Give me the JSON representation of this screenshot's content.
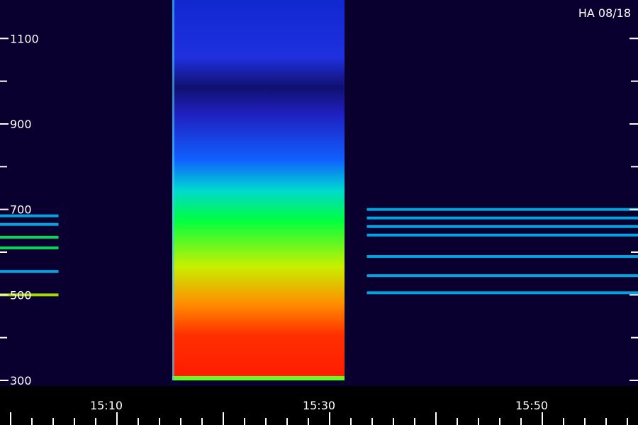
{
  "chart_data": {
    "type": "heatmap",
    "title": "",
    "label_top_right": "HA 08/18",
    "xlabel": "",
    "ylabel": "",
    "xlim": [
      "15:02",
      "15:38"
    ],
    "ylim": [
      300,
      1190
    ],
    "x_tick_labels": [
      "15:10",
      "15:30",
      "15:50"
    ],
    "x_tick_minutes": [
      10,
      30,
      50
    ],
    "y_tick_values": [
      300,
      500,
      700,
      900,
      1100
    ],
    "y_minor_tick_values": [
      400,
      600,
      800,
      1000
    ],
    "grid": false,
    "colormap": [
      "#0a0030",
      "#1020d0",
      "#00c0ff",
      "#00ff60",
      "#c0ff00",
      "#ff8000",
      "#ff1000"
    ],
    "background_color": "#0a0030",
    "bands": [
      {
        "t_start_min": 16.2,
        "t_end_min": 32.4,
        "f_min": 300,
        "f_max": 1190,
        "intensity_low": 0.9,
        "intensity_high": 0.35
      }
    ],
    "lines": [
      {
        "t_start_min": 0,
        "t_end_min": 5.5,
        "freq": 500,
        "intensity": 0.6
      },
      {
        "t_start_min": 0,
        "t_end_min": 5.5,
        "freq": 555,
        "intensity": 0.4
      },
      {
        "t_start_min": 0,
        "t_end_min": 5.5,
        "freq": 610,
        "intensity": 0.5
      },
      {
        "t_start_min": 0,
        "t_end_min": 5.5,
        "freq": 635,
        "intensity": 0.5
      },
      {
        "t_start_min": 0,
        "t_end_min": 5.5,
        "freq": 665,
        "intensity": 0.4
      },
      {
        "t_start_min": 0,
        "t_end_min": 5.5,
        "freq": 685,
        "intensity": 0.4
      },
      {
        "t_start_min": 34.5,
        "t_end_min": 60,
        "freq": 505,
        "intensity": 0.3
      },
      {
        "t_start_min": 34.5,
        "t_end_min": 60,
        "freq": 545,
        "intensity": 0.3
      },
      {
        "t_start_min": 34.5,
        "t_end_min": 60,
        "freq": 590,
        "intensity": 0.3
      },
      {
        "t_start_min": 34.5,
        "t_end_min": 60,
        "freq": 640,
        "intensity": 0.35
      },
      {
        "t_start_min": 34.5,
        "t_end_min": 60,
        "freq": 660,
        "intensity": 0.35
      },
      {
        "t_start_min": 34.5,
        "t_end_min": 60,
        "freq": 680,
        "intensity": 0.35
      },
      {
        "t_start_min": 34.5,
        "t_end_min": 60,
        "freq": 700,
        "intensity": 0.3
      }
    ]
  }
}
